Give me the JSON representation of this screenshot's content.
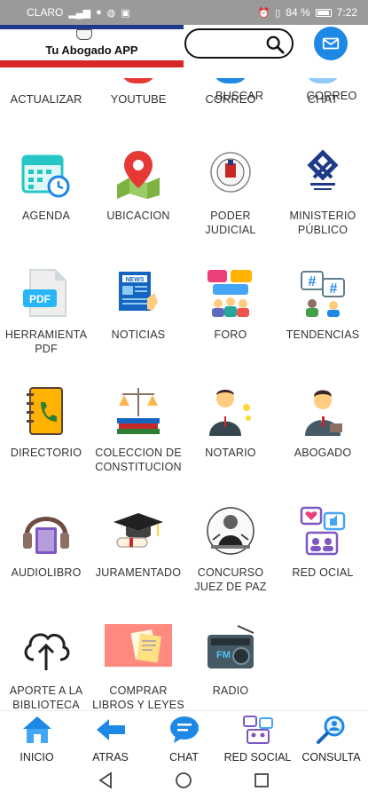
{
  "status_bar": {
    "carrier": "CLARO",
    "battery": "84 %",
    "time": "7:22"
  },
  "header": {
    "app_title": "Tu Abogado APP",
    "search_placeholder": "",
    "labels": [
      "BUSCAR",
      "CORREO"
    ]
  },
  "partial_row": [
    "ACTUALIZAR",
    "YOUTUBE",
    "CORREO",
    "CHAT"
  ],
  "grid": [
    {
      "line1": "AGENDA",
      "line2": ""
    },
    {
      "line1": "UBICACION",
      "line2": ""
    },
    {
      "line1": "PODER",
      "line2": "JUDICIAL"
    },
    {
      "line1": "MINISTERIO",
      "line2": "PÚBLICO"
    },
    {
      "line1": "HERRAMIENTA",
      "line2": "PDF"
    },
    {
      "line1": "NOTICIAS",
      "line2": ""
    },
    {
      "line1": "FORO",
      "line2": ""
    },
    {
      "line1": "TENDENCIAS",
      "line2": ""
    },
    {
      "line1": "DIRECTORIO",
      "line2": ""
    },
    {
      "line1": "COLECCION DE",
      "line2": "CONSTITUCION"
    },
    {
      "line1": "NOTARIO",
      "line2": ""
    },
    {
      "line1": "ABOGADO",
      "line2": ""
    },
    {
      "line1": "AUDIOLIBRO",
      "line2": ""
    },
    {
      "line1": "JURAMENTADO",
      "line2": ""
    },
    {
      "line1": "CONCURSO",
      "line2": "JUEZ DE PAZ"
    },
    {
      "line1": "RED OCIAL",
      "line2": ""
    },
    {
      "line1": "APORTE A LA",
      "line2": "BIBLIOTECA"
    },
    {
      "line1": "COMPRAR",
      "line2": "LIBROS Y LEYES"
    },
    {
      "line1": "RADIO",
      "line2": ""
    }
  ],
  "bottom_nav": [
    "INICIO",
    "ATRAS",
    "CHAT",
    "RED SOCIAL",
    "CONSULTA"
  ],
  "icons": {
    "mail": "mail-icon",
    "search": "search-icon",
    "home": "home-icon",
    "back": "arrow-left-icon",
    "chat": "chat-bubble-icon",
    "social": "social-network-icon",
    "consult": "magnifier-person-icon"
  },
  "colors": {
    "accent_blue": "#1e88e5",
    "flag_red": "#d62828",
    "flag_blue": "#1e3a8a"
  }
}
